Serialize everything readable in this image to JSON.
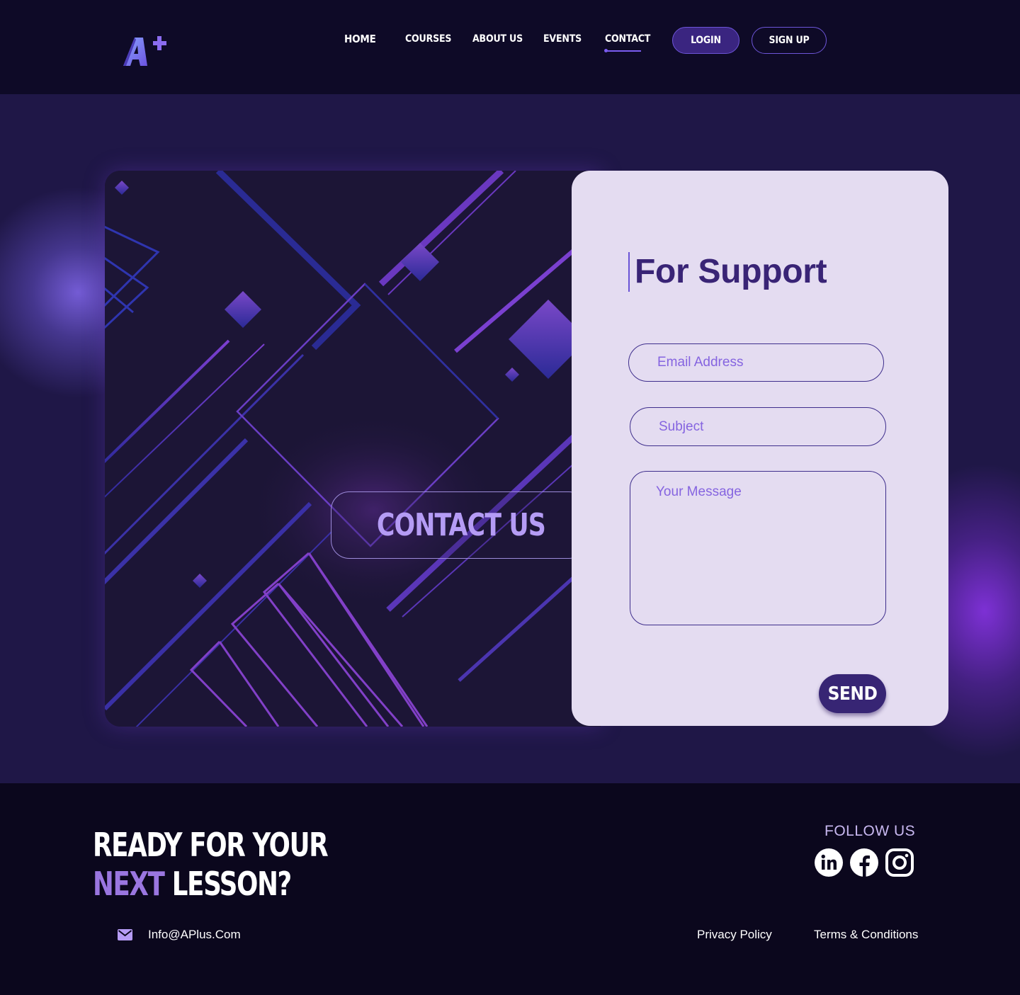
{
  "header": {
    "logo_alt": "A+",
    "nav": [
      {
        "label": "HOME"
      },
      {
        "label": "COURSES"
      },
      {
        "label": "ABOUT US"
      },
      {
        "label": "EVENTS"
      },
      {
        "label": "CONTACT"
      }
    ],
    "active_nav": "CONTACT",
    "login_label": "LOGIN",
    "signup_label": "SIGN UP"
  },
  "hero": {
    "contact_title": "CONTACT US"
  },
  "form": {
    "title": "For Support",
    "email_placeholder": "Email Address",
    "subject_placeholder": "Subject",
    "message_placeholder": "Your Message",
    "send_label": "SEND"
  },
  "footer": {
    "cta_line1": "READY FOR YOUR",
    "cta_line2_accent": "NEXT",
    "cta_line2_rest": " LESSON?",
    "follow_label": "FOLLOW US",
    "socials": [
      "linkedin-icon",
      "facebook-icon",
      "instagram-icon"
    ],
    "email": "Info@APlus.Com",
    "privacy_label": "Privacy Policy",
    "terms_label": "Terms & Conditions"
  },
  "colors": {
    "header_bg": "#0e0a27",
    "main_bg": "#1f1747",
    "accent": "#6d55d8",
    "form_bg": "#e4dcf1",
    "title_color": "#392476",
    "footer_bg": "#0b071d",
    "cta_accent": "#9a76e0"
  }
}
